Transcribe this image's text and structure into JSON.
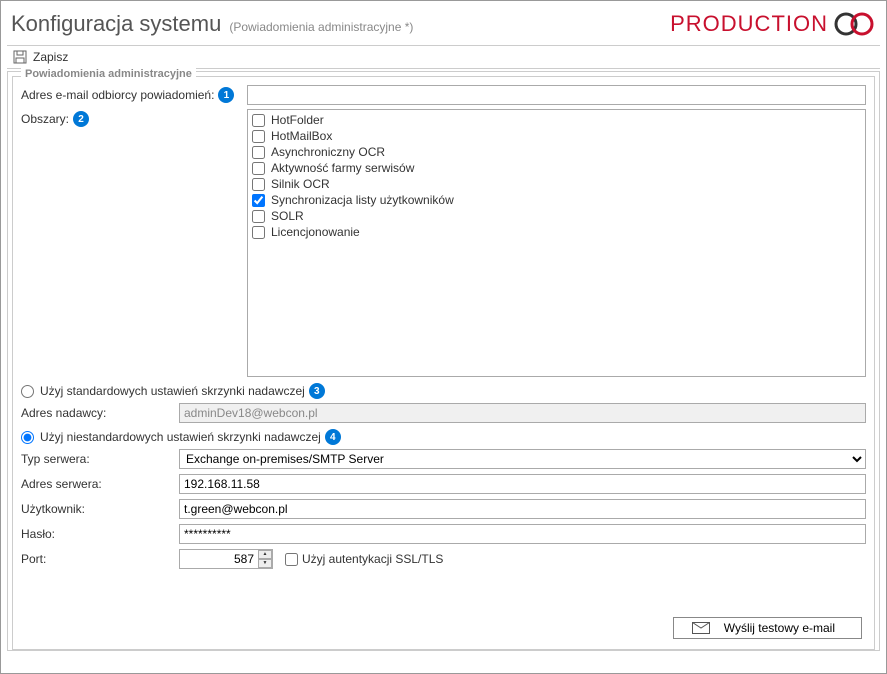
{
  "header": {
    "title": "Konfiguracja systemu",
    "subtitle": "(Powiadomienia administracyjne *)",
    "production": "PRODUCTION"
  },
  "toolbar": {
    "save": "Zapisz"
  },
  "fieldset": {
    "legend": "Powiadomienia administracyjne",
    "email_label": "Adres e-mail odbiorcy powiadomień:",
    "email_value": "",
    "areas_label": "Obszary:",
    "areas": [
      {
        "label": "HotFolder",
        "checked": false
      },
      {
        "label": "HotMailBox",
        "checked": false
      },
      {
        "label": "Asynchroniczny OCR",
        "checked": false
      },
      {
        "label": "Aktywność farmy serwisów",
        "checked": false
      },
      {
        "label": "Silnik OCR",
        "checked": false
      },
      {
        "label": "Synchronizacja listy użytkowników",
        "checked": true
      },
      {
        "label": "SOLR",
        "checked": false
      },
      {
        "label": "Licencjonowanie",
        "checked": false
      }
    ],
    "radio_std": "Użyj standardowych ustawień skrzynki nadawczej",
    "radio_custom": "Użyj niestandardowych ustawień skrzynki nadawczej",
    "sender_label": "Adres nadawcy:",
    "sender_value": "adminDev18@webcon.pl",
    "server_type_label": "Typ serwera:",
    "server_type_value": "Exchange on-premises/SMTP Server",
    "server_addr_label": "Adres serwera:",
    "server_addr_value": "192.168.11.58",
    "user_label": "Użytkownik:",
    "user_value": "t.green@webcon.pl",
    "pass_label": "Hasło:",
    "pass_value": "**********",
    "port_label": "Port:",
    "port_value": "587",
    "ssl_label": "Użyj autentykacji SSL/TLS",
    "send_test": "Wyślij testowy e-mail"
  },
  "badges": {
    "b1": "1",
    "b2": "2",
    "b3": "3",
    "b4": "4"
  }
}
